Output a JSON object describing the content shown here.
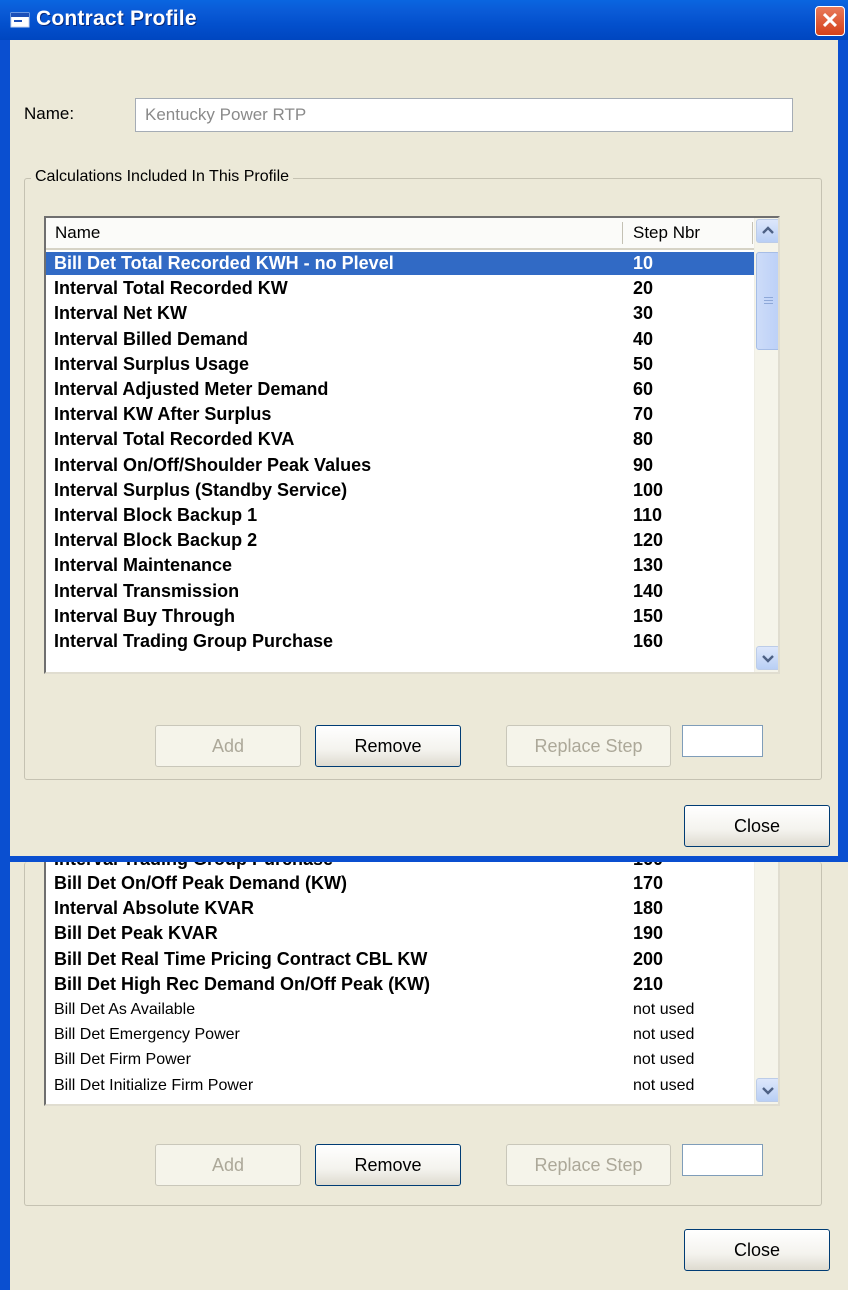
{
  "window": {
    "title": "Contract Profile",
    "close_glyph": "✕",
    "name_label": "Name:",
    "name_value": "Kentucky Power RTP",
    "group_caption": "Calculations Included In This Profile",
    "columns": {
      "name": "Name",
      "step": "Step Nbr"
    },
    "rows": [
      {
        "name": "Bill Det Total Recorded KWH - no Plevel",
        "step": "10",
        "selected": true
      },
      {
        "name": "Interval Total Recorded KW",
        "step": "20"
      },
      {
        "name": "Interval Net KW",
        "step": "30"
      },
      {
        "name": "Interval Billed Demand",
        "step": "40"
      },
      {
        "name": "Interval Surplus Usage",
        "step": "50"
      },
      {
        "name": "Interval Adjusted Meter Demand",
        "step": "60"
      },
      {
        "name": "Interval KW After Surplus",
        "step": "70"
      },
      {
        "name": "Interval Total Recorded KVA",
        "step": "80"
      },
      {
        "name": "Interval On/Off/Shoulder Peak Values",
        "step": "90"
      },
      {
        "name": "Interval Surplus (Standby Service)",
        "step": "100"
      },
      {
        "name": "Interval Block Backup 1",
        "step": "110"
      },
      {
        "name": "Interval Block Backup 2",
        "step": "120"
      },
      {
        "name": "Interval Maintenance",
        "step": "130"
      },
      {
        "name": "Interval Transmission",
        "step": "140"
      },
      {
        "name": "Interval Buy Through",
        "step": "150"
      },
      {
        "name": "Interval Trading Group Purchase",
        "step": "160"
      }
    ],
    "buttons": {
      "add": "Add",
      "remove": "Remove",
      "replace": "Replace Step",
      "close": "Close"
    }
  },
  "continuation": {
    "cut_row": {
      "name": "Interval Trading Group Purchase",
      "step": "160"
    },
    "rows": [
      {
        "name": "Bill Det On/Off Peak Demand (KW)",
        "step": "170",
        "bold": true
      },
      {
        "name": "Interval Absolute KVAR",
        "step": "180",
        "bold": true
      },
      {
        "name": "Bill Det Peak KVAR",
        "step": "190",
        "bold": true
      },
      {
        "name": "Bill Det Real Time Pricing Contract CBL KW",
        "step": "200",
        "bold": true
      },
      {
        "name": "Bill Det High Rec Demand On/Off Peak (KW)",
        "step": "210",
        "bold": true
      },
      {
        "name": "Bill Det As Available",
        "step": "not used",
        "bold": false
      },
      {
        "name": "Bill Det Emergency Power",
        "step": "not used",
        "bold": false
      },
      {
        "name": "Bill Det Firm Power",
        "step": "not used",
        "bold": false
      },
      {
        "name": "Bill Det Initialize Firm Power",
        "step": "not used",
        "bold": false
      }
    ],
    "buttons": {
      "add": "Add",
      "remove": "Remove",
      "replace": "Replace Step",
      "close": "Close"
    }
  },
  "icons": {
    "window_icon": "window-icon",
    "scroll_up": "chevron-up-icon",
    "scroll_down": "chevron-down-icon"
  },
  "colors": {
    "title_bar": "#0350cd",
    "selection": "#316ac5",
    "close_button": "#d5411a"
  }
}
